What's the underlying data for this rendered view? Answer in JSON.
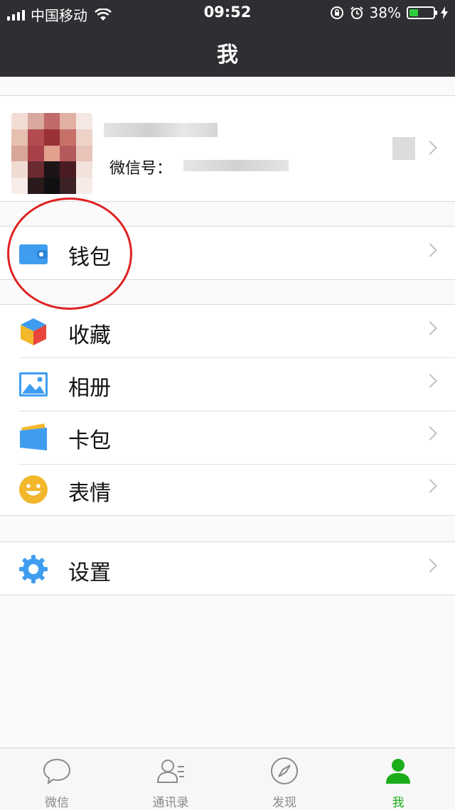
{
  "status_bar": {
    "carrier": "中国移动",
    "time": "09:52",
    "battery_percent": "38%",
    "battery_level": 0.38
  },
  "nav": {
    "title": "我"
  },
  "profile": {
    "wechat_id_label": "微信号："
  },
  "menu": {
    "wallet": "钱包",
    "favorites": "收藏",
    "album": "相册",
    "cards": "卡包",
    "stickers": "表情",
    "settings": "设置"
  },
  "tabs": [
    {
      "label": "微信",
      "icon": "chat-bubble-icon"
    },
    {
      "label": "通讯录",
      "icon": "contacts-icon"
    },
    {
      "label": "发现",
      "icon": "compass-icon"
    },
    {
      "label": "我",
      "icon": "person-icon"
    }
  ],
  "colors": {
    "header_bg": "#2f2f33",
    "accent_green": "#1aad19",
    "highlight_circle": "#e02020",
    "wallet_blue": "#3f9df0"
  }
}
